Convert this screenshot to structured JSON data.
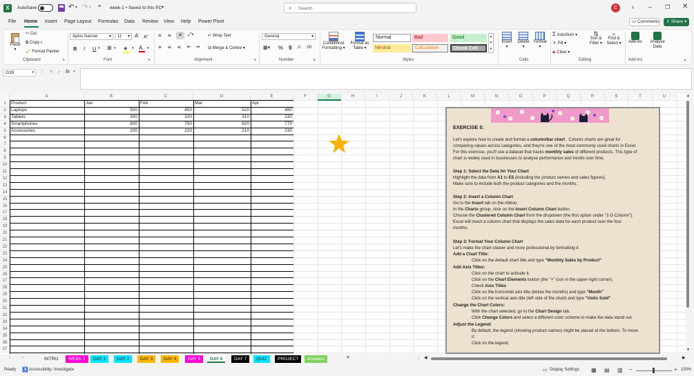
{
  "titlebar": {
    "autosave": "AutoSave",
    "doc_title": "week-1 • Saved to this PC",
    "search_placeholder": "Search",
    "avatar": "C"
  },
  "menu": [
    "File",
    "Home",
    "Insert",
    "Page Layout",
    "Formulas",
    "Data",
    "Review",
    "View",
    "Help",
    "Power Pivot"
  ],
  "menu_active": "Home",
  "comments_label": "Comments",
  "share_label": "Share",
  "ribbon": {
    "clipboard": {
      "paste": "Paste",
      "cut": "Cut",
      "copy": "Copy",
      "format_painter": "Format Painter",
      "label": "Clipboard"
    },
    "font": {
      "name": "Aptos Narrow",
      "size": "11",
      "label": "Font",
      "bold": "B",
      "italic": "I",
      "underline": "U"
    },
    "alignment": {
      "wrap": "Wrap Text",
      "merge": "Merge & Centre",
      "label": "Alignment"
    },
    "number": {
      "format": "General",
      "label": "Number"
    },
    "styles": {
      "cond_format": "Conditional Formatting",
      "format_table": "Format as Table",
      "normal": "Normal",
      "bad": "Bad",
      "good": "Good",
      "neutral": "Neutral",
      "calculation": "Calculation",
      "check_cell": "Check Cell",
      "label": "Styles"
    },
    "cells": {
      "insert": "Insert",
      "delete": "Delete",
      "format": "Format",
      "label": "Cells"
    },
    "editing": {
      "autosum": "AutoSum",
      "fill": "Fill",
      "clear": "Clear",
      "sort": "Sort & Filter",
      "find": "Find & Select",
      "label": "Editing"
    },
    "addins": {
      "addins": "Add-ins",
      "analyse": "Analyse Data",
      "label": "Add-ins"
    }
  },
  "colors": {
    "accent": "#217346",
    "home_underline": "#107c41",
    "normal_bg": "#ffffff",
    "bad_bg": "#ffc7ce",
    "bad_fg": "#9c0006",
    "good_bg": "#c6efce",
    "good_fg": "#006100",
    "neutral_bg": "#ffeb9c",
    "neutral_fg": "#9c5700",
    "calc_bg": "#f2f2f2",
    "calc_fg": "#fa7d00",
    "check_bg": "#a5a5a5",
    "panel_bg": "#ece2cf",
    "star": "#f6b300"
  },
  "formula": {
    "namebox": "G39",
    "fx": "fx",
    "value": ""
  },
  "columns": [
    "A",
    "B",
    "C",
    "D",
    "E",
    "F",
    "G",
    "H",
    "I",
    "J",
    "K",
    "L",
    "M",
    "N",
    "O",
    "P",
    "Q",
    "R",
    "S",
    "T",
    "U"
  ],
  "rows": 37,
  "table": {
    "headers": [
      "Product",
      "Jan",
      "Feb",
      "Mar",
      "Apr"
    ],
    "rows": [
      [
        "Laptops",
        500,
        450,
        520,
        480
      ],
      [
        "Tablets",
        300,
        320,
        310,
        330
      ],
      [
        "Smartphones",
        800,
        750,
        820,
        770
      ],
      [
        "Accessories",
        200,
        220,
        210,
        230
      ]
    ]
  },
  "star_icon": "star-icon",
  "panel": {
    "title": "EXERCISE 5:",
    "intro_a": "Let's explore how to create and format a ",
    "intro_b": "column/bar chart",
    "intro_c": " . Column charts are great for",
    "intro2": "comparing values across categories, and they're one of the most commonly used charts in Excel.",
    "intro3a": "For this exercise, you'll use a dataset that tracks ",
    "intro3b": "monthly sales",
    "intro3c": " of different products. This type of",
    "intro4": "chart is widely used in businesses to analyse performance and trends over time.",
    "s1": "Step 1: Select the Data for Your Chart",
    "s1a1": "Highlight the data from ",
    "s1a2": "A1",
    "s1a3": " to ",
    "s1a4": "E5",
    "s1a5": " (including the product names and sales figures).",
    "s1b": "Make sure to include both the product categories and the months.",
    "s2": "Step 2: Insert a Column Chart",
    "s2a1": "Go to the ",
    "s2a2": "Insert",
    "s2a3": " tab on the ribbon.",
    "s2b1": "In the ",
    "s2b2": "Charts",
    "s2b3": " group, click on the ",
    "s2b4": "Insert Column Chart",
    "s2b5": " button.",
    "s2c1": "Choose the ",
    "s2c2": "Clustered Column Chart",
    "s2c3": " from the dropdown (the first option under \"2-D Column\").",
    "s2d": "Excel will insert a column chart that displays the sales data for each product over the four",
    "s2e": "months.",
    "s3": "Step 3: Format Your Column Chart",
    "s3a": "Let's make the chart clearer and more professional by formatting it.",
    "s3t": "Add a Chart Title:",
    "s3t1a": "Click on the default chart title and type ",
    "s3t1b": "\"Monthly Sales by Product\"",
    "s3x": "Add Axis Titles:",
    "s3x1": "Click on the chart to activate it.",
    "s3x2a": "Click on the ",
    "s3x2b": "Chart Elements",
    "s3x2c": " button (the \"+\" icon in the upper-right corner).",
    "s3x3a": "Check ",
    "s3x3b": "Axis Titles",
    "s3x4a": "Click on the horizontal axis title (below the months) and type ",
    "s3x4b": "\"Month\"",
    "s3x5a": "Click on the vertical axis title (left side of the chart) and type ",
    "s3x5b": "\"Units Sold\"",
    "s3c": "Change the Chart Colors:",
    "s3c1a": "With the chart selected, go to the ",
    "s3c1b": "Chart Design",
    "s3c1c": " tab.",
    "s3c2a": "Click ",
    "s3c2b": "Change Colors",
    "s3c2c": " and select a different color scheme to make the data stand out.",
    "s3l": "Adjust the Legend:",
    "s3l1": "By default, the legend (showing product names) might be placed at the bottom. To move",
    "s3l2": "it:",
    "s3l3": "Click on the legend."
  },
  "sheet_tabs": [
    {
      "label": "INTRO",
      "bg": "#f3f3f3",
      "fg": "#222"
    },
    {
      "label": "WEEK 1",
      "bg": "#ff00d4",
      "fg": "#fff"
    },
    {
      "label": "DAY 1",
      "bg": "#00e5ff",
      "fg": "#222"
    },
    {
      "label": "DAY 2",
      "bg": "#00e5ff",
      "fg": "#222"
    },
    {
      "label": "DAY 3",
      "bg": "#ffb800",
      "fg": "#222"
    },
    {
      "label": "DAY 4",
      "bg": "#ffb800",
      "fg": "#222"
    },
    {
      "label": "DAY 5",
      "bg": "#ff00d4",
      "fg": "#fff"
    },
    {
      "label": "DAY 6",
      "bg": "#ffffff",
      "fg": "#217346"
    },
    {
      "label": "DAY 7",
      "bg": "#000000",
      "fg": "#fff"
    },
    {
      "label": "QUIZ",
      "bg": "#00e5ff",
      "fg": "#222"
    },
    {
      "label": "PROJECT",
      "bg": "#000000",
      "fg": "#fff"
    },
    {
      "label": "Answers",
      "bg": "#7dd35b",
      "fg": "#fff"
    }
  ],
  "status": {
    "ready": "Ready",
    "accessibility": "Accessibility: Investigate",
    "display": "Display Settings",
    "zoom": "100%"
  }
}
